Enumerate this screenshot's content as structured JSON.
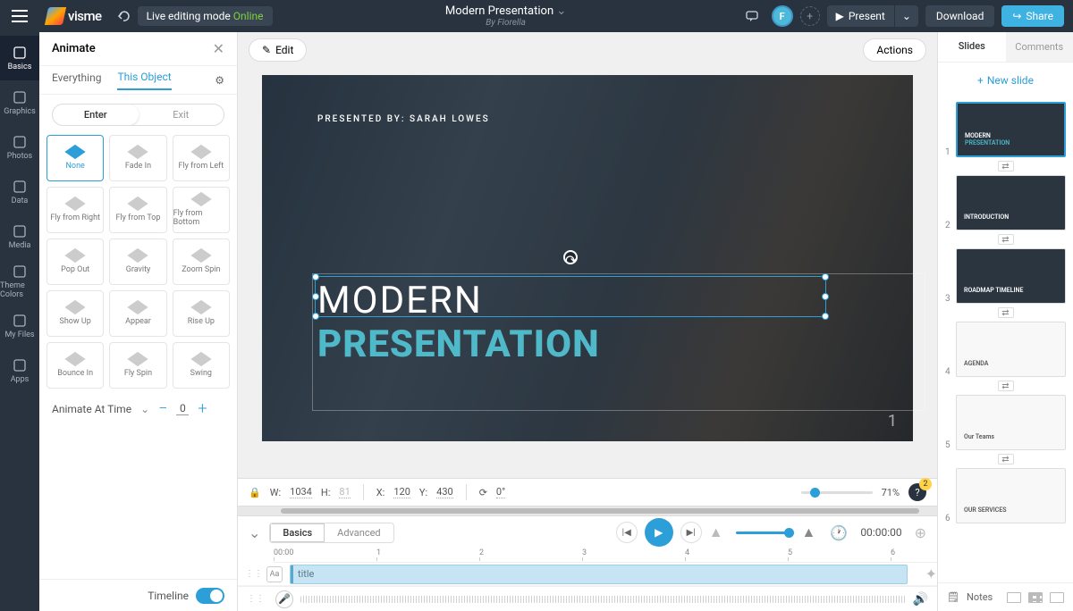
{
  "top": {
    "logo": "visme",
    "mode_label": "Live editing mode",
    "mode_status": "Online",
    "title": "Modern Presentation",
    "author": "By Fiorella",
    "avatar_initial": "F",
    "present": "Present",
    "download": "Download",
    "share": "Share"
  },
  "iconbar": [
    {
      "label": "Basics"
    },
    {
      "label": "Graphics"
    },
    {
      "label": "Photos"
    },
    {
      "label": "Data"
    },
    {
      "label": "Media"
    },
    {
      "label": "Theme Colors"
    },
    {
      "label": "My Files"
    },
    {
      "label": "Apps"
    }
  ],
  "animate": {
    "heading": "Animate",
    "tabs": {
      "everything": "Everything",
      "this_object": "This Object"
    },
    "enter": "Enter",
    "exit": "Exit",
    "options": [
      "None",
      "Fade In",
      "Fly from Left",
      "Fly from Right",
      "Fly from Top",
      "Fly from Bottom",
      "Pop Out",
      "Gravity",
      "Zoom Spin",
      "Show Up",
      "Appear",
      "Rise Up",
      "Bounce In",
      "Fly Spin",
      "Swing"
    ],
    "animate_at_time": "Animate At Time",
    "animate_value": "0",
    "footer_label": "Timeline"
  },
  "canvas": {
    "edit": "Edit",
    "actions": "Actions",
    "presented_by": "PRESENTED BY: SARAH LOWES",
    "line1": "MODERN",
    "line2": "PRESENTATION",
    "slide_number": "1"
  },
  "status": {
    "w_label": "W:",
    "w": "1034",
    "h_label": "H:",
    "h": "81",
    "x_label": "X:",
    "x": "120",
    "y_label": "Y:",
    "y": "430",
    "rot": "0°",
    "zoom": "71%",
    "help_badge": "2"
  },
  "timeline": {
    "tabs": {
      "basics": "Basics",
      "advanced": "Advanced"
    },
    "time": "00:00:00",
    "ticks": [
      "00:00",
      "1",
      "2",
      "3",
      "4",
      "5",
      "6"
    ],
    "track_label": "title"
  },
  "right": {
    "tabs": {
      "slides": "Slides",
      "comments": "Comments"
    },
    "new_slide": "New slide",
    "notes": "Notes",
    "thumbs": [
      {
        "n": "1",
        "sel": true,
        "dark": true,
        "t1": "MODERN",
        "t2": "PRESENTATION"
      },
      {
        "n": "2",
        "dark": true,
        "t1": "INTRODUCTION"
      },
      {
        "n": "3",
        "dark": true,
        "t1": "ROADMAP TIMELINE"
      },
      {
        "n": "4",
        "dark": false,
        "t1": "AGENDA"
      },
      {
        "n": "5",
        "dark": false,
        "t1": "Our Teams"
      },
      {
        "n": "6",
        "dark": false,
        "t1": "OUR SERVICES"
      }
    ]
  }
}
